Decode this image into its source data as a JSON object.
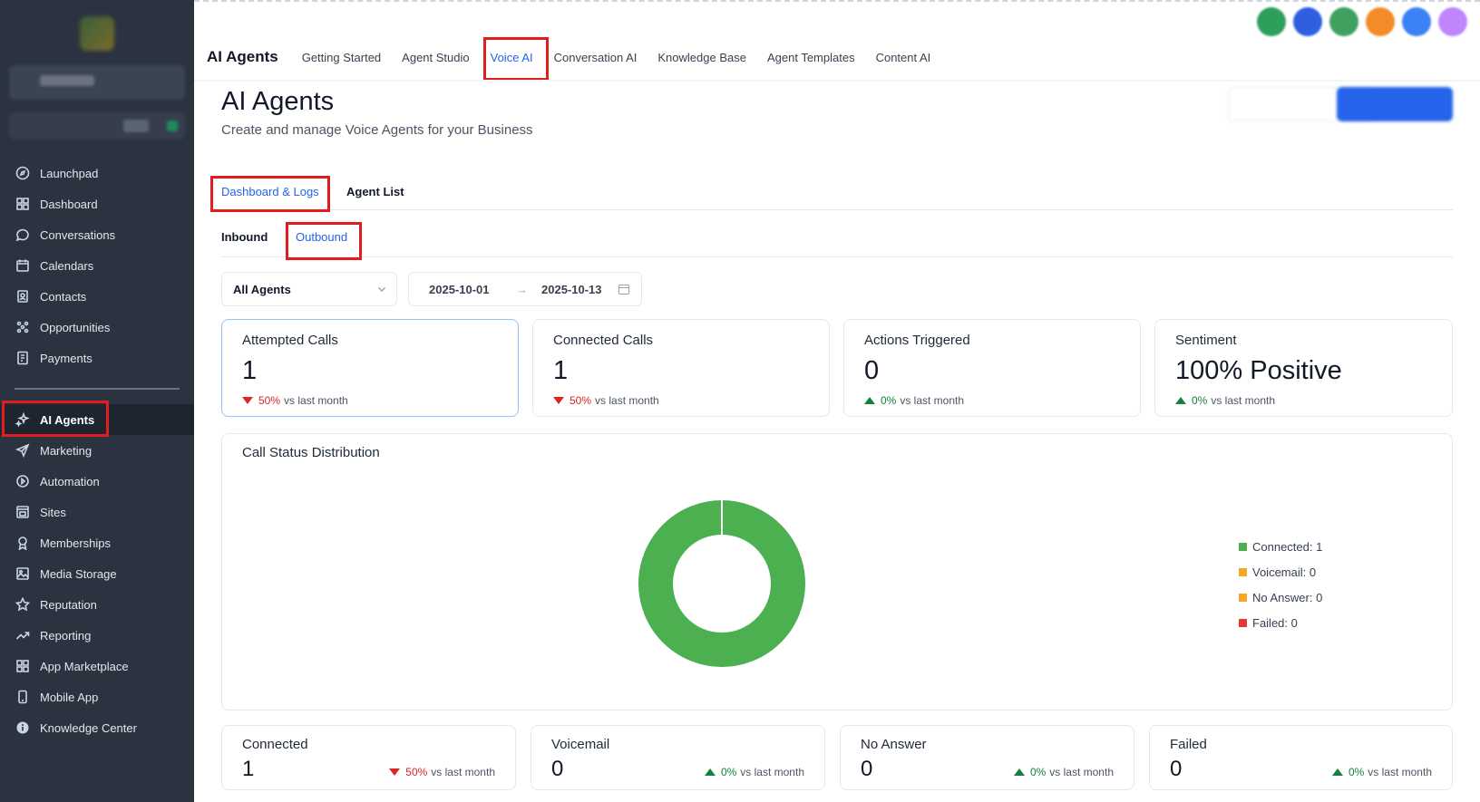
{
  "sidebar": {
    "items": [
      {
        "label": "Launchpad",
        "icon": "launchpad-icon"
      },
      {
        "label": "Dashboard",
        "icon": "grid-icon"
      },
      {
        "label": "Conversations",
        "icon": "chat-icon"
      },
      {
        "label": "Calendars",
        "icon": "calendar-icon"
      },
      {
        "label": "Contacts",
        "icon": "contacts-icon"
      },
      {
        "label": "Opportunities",
        "icon": "opportunities-icon"
      },
      {
        "label": "Payments",
        "icon": "payments-icon"
      },
      {
        "label": "AI Agents",
        "icon": "sparkle-icon"
      },
      {
        "label": "Marketing",
        "icon": "send-icon"
      },
      {
        "label": "Automation",
        "icon": "automation-icon"
      },
      {
        "label": "Sites",
        "icon": "sites-icon"
      },
      {
        "label": "Memberships",
        "icon": "award-icon"
      },
      {
        "label": "Media Storage",
        "icon": "image-icon"
      },
      {
        "label": "Reputation",
        "icon": "star-icon"
      },
      {
        "label": "Reporting",
        "icon": "trend-icon"
      },
      {
        "label": "App Marketplace",
        "icon": "grid-icon"
      },
      {
        "label": "Mobile App",
        "icon": "phone-icon"
      },
      {
        "label": "Knowledge Center",
        "icon": "info-icon"
      }
    ]
  },
  "topnav": {
    "brand": "AI Agents",
    "tabs": [
      "Getting Started",
      "Agent Studio",
      "Voice AI",
      "Conversation AI",
      "Knowledge Base",
      "Agent Templates",
      "Content AI"
    ],
    "active": "Voice AI"
  },
  "page": {
    "title": "AI Agents",
    "subtitle": "Create and manage Voice Agents for your Business"
  },
  "subtabs": {
    "dashboard": "Dashboard & Logs",
    "agent_list": "Agent List"
  },
  "direction": {
    "inbound": "Inbound",
    "outbound": "Outbound"
  },
  "filters": {
    "agent": "All Agents",
    "date_from": "2025-10-01",
    "date_to": "2025-10-13"
  },
  "cards": {
    "attempted": {
      "label": "Attempted Calls",
      "value": "1",
      "pct": "50%",
      "suffix": "vs last month"
    },
    "connected": {
      "label": "Connected Calls",
      "value": "1",
      "pct": "50%",
      "suffix": "vs last month"
    },
    "actions": {
      "label": "Actions Triggered",
      "value": "0",
      "pct": "0%",
      "suffix": "vs last month"
    },
    "sentiment": {
      "label": "Sentiment",
      "value": "100% Positive",
      "pct": "0%",
      "suffix": "vs last month"
    }
  },
  "distribution": {
    "title": "Call Status Distribution",
    "legend": [
      "Connected: 1",
      "Voicemail: 0",
      "No Answer: 0",
      "Failed: 0"
    ]
  },
  "bottom": {
    "connected": {
      "label": "Connected",
      "value": "1",
      "pct": "50%",
      "suffix": "vs last month"
    },
    "voicemail": {
      "label": "Voicemail",
      "value": "0",
      "pct": "0%",
      "suffix": "vs last month"
    },
    "no_answer": {
      "label": "No Answer",
      "value": "0",
      "pct": "0%",
      "suffix": "vs last month"
    },
    "failed": {
      "label": "Failed",
      "value": "0",
      "pct": "0%",
      "suffix": "vs last month"
    }
  },
  "colors": {
    "accent": "#2563eb",
    "connected": "#4caf50",
    "voicemail": "#f5a623",
    "no_answer": "#f5a623",
    "failed": "#e53935",
    "down": "#dc2626",
    "up": "#15803d"
  }
}
